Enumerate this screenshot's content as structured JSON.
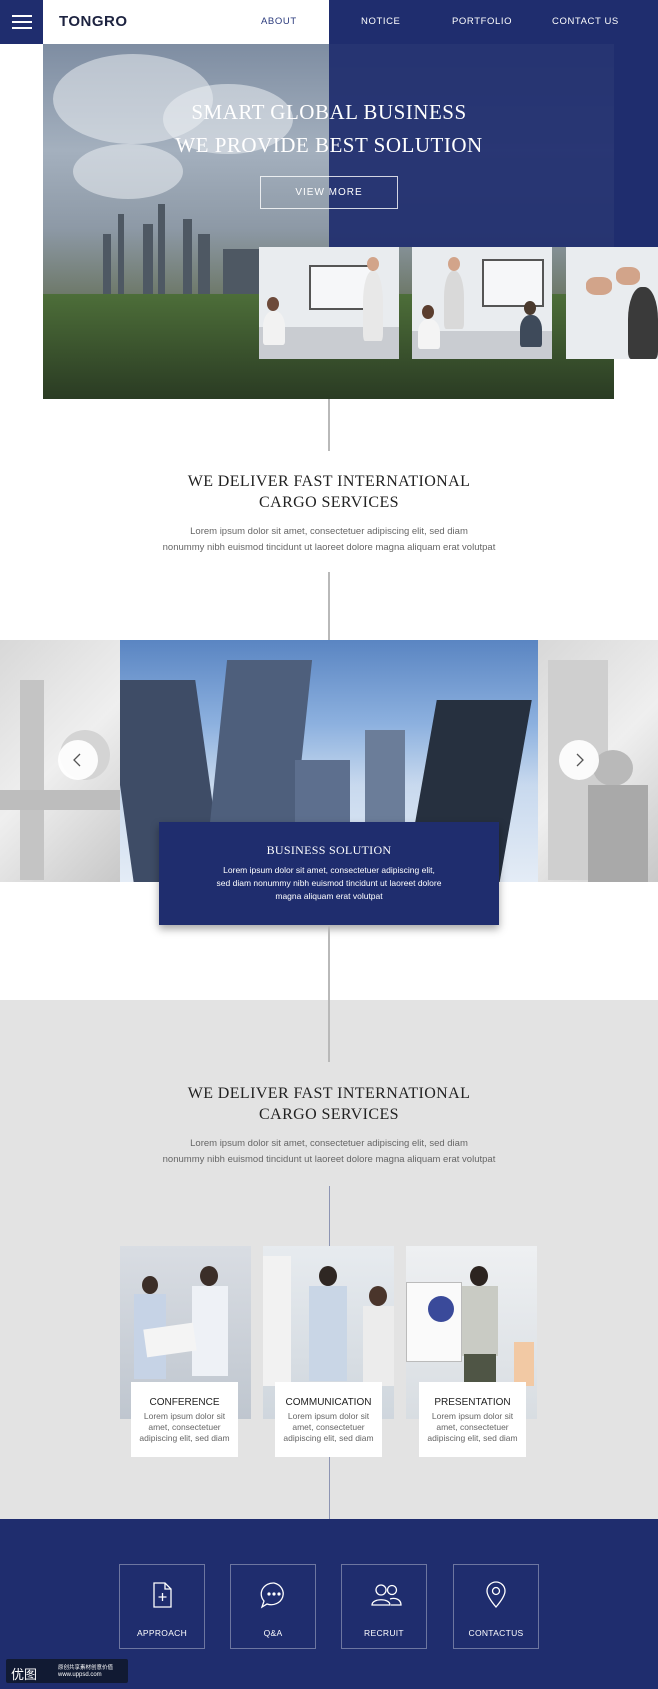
{
  "header": {
    "logo": "TONGRO",
    "nav": [
      "ABOUT",
      "NOTICE",
      "PORTFOLIO",
      "CONTACT US"
    ]
  },
  "hero": {
    "title_line1": "SMART GLOBAL BUSINESS",
    "title_line2": "WE PROVIDE BEST SOLUTION",
    "button": "VIEW MORE"
  },
  "section1": {
    "title_line1": "WE DELIVER FAST INTERNATIONAL",
    "title_line2": "CARGO SERVICES",
    "text_line1": "Lorem ipsum dolor sit amet, consectetuer adipiscing elit, sed diam",
    "text_line2": "nonummy nibh euismod tincidunt ut laoreet dolore magna aliquam erat volutpat"
  },
  "slider": {
    "card_title": "BUSINESS SOLUTION",
    "card_line1": "Lorem ipsum dolor sit amet, consectetuer adipiscing elit,",
    "card_line2": "sed diam nonummy nibh euismod tincidunt ut laoreet dolore",
    "card_line3": "magna aliquam erat volutpat"
  },
  "section2": {
    "title_line1": "WE DELIVER FAST INTERNATIONAL",
    "title_line2": "CARGO SERVICES",
    "text_line1": "Lorem ipsum dolor sit amet, consectetuer adipiscing elit, sed diam",
    "text_line2": "nonummy nibh euismod tincidunt ut laoreet dolore magna aliquam erat volutpat",
    "cards": [
      {
        "title": "CONFERENCE",
        "line1": "Lorem ipsum dolor sit",
        "line2": "amet, consectetuer",
        "line3": "adipiscing elit, sed diam"
      },
      {
        "title": "COMMUNICATION",
        "line1": "Lorem ipsum dolor sit",
        "line2": "amet, consectetuer",
        "line3": "adipiscing elit, sed diam"
      },
      {
        "title": "PRESENTATION",
        "line1": "Lorem ipsum dolor sit",
        "line2": "amet, consectetuer",
        "line3": "adipiscing elit, sed diam"
      }
    ]
  },
  "footer": {
    "items": [
      {
        "label": "APPROACH",
        "icon": "document-plus-icon"
      },
      {
        "label": "Q&A",
        "icon": "chat-bubble-icon"
      },
      {
        "label": "RECRUIT",
        "icon": "users-icon"
      },
      {
        "label": "CONTACTUS",
        "icon": "location-pin-icon"
      }
    ]
  },
  "watermark": {
    "logo": "优图",
    "line1": "原创共享素材创意价值",
    "line2": "www.uppsd.com"
  },
  "colors": {
    "brand_blue": "#1f2d6e",
    "gray_bg": "#e3e3e3"
  }
}
